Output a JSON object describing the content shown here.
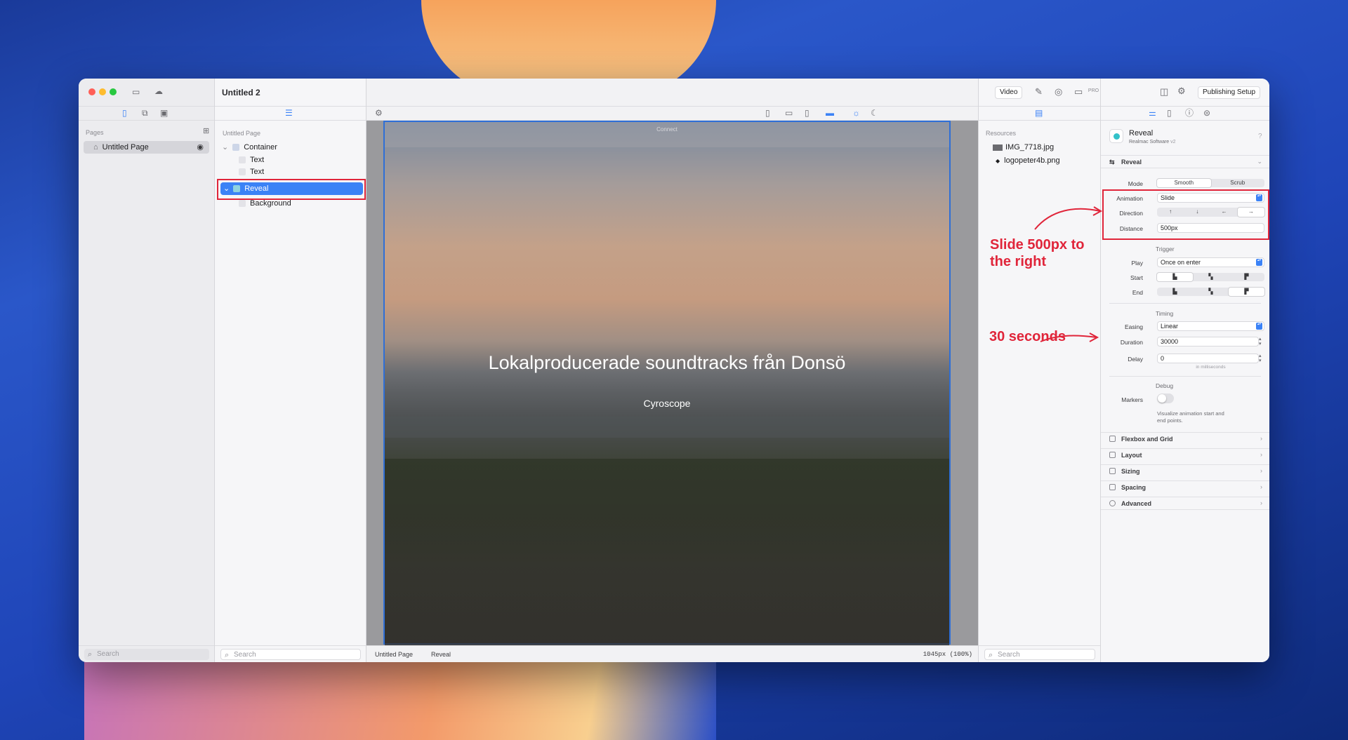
{
  "window": {
    "title": "Untitled 2",
    "license": "PRO LICENSE",
    "video_button": "Video",
    "publishing_button": "Publishing Setup"
  },
  "sidebar": {
    "section": "Pages",
    "pages": [
      {
        "label": "Untitled Page"
      }
    ],
    "search_placeholder": "Search"
  },
  "layers": {
    "header": "Untitled Page",
    "items": [
      {
        "label": "Container",
        "depth": 0
      },
      {
        "label": "Text",
        "depth": 1
      },
      {
        "label": "Text",
        "depth": 1
      },
      {
        "label": "Reveal",
        "depth": 0,
        "selected": true
      },
      {
        "label": "Background",
        "depth": 1
      }
    ],
    "search_placeholder": "Search"
  },
  "canvas": {
    "connect_label": "Connect",
    "title": "Lokalproducerade soundtracks från Donsö",
    "subtitle": "Cyroscope",
    "breadcrumb": [
      "Untitled Page",
      "Reveal"
    ],
    "size_readout": "1045px (100%)"
  },
  "resources": {
    "section": "Resources",
    "files": [
      {
        "name": "IMG_7718.jpg"
      },
      {
        "name": "logopeter4b.png"
      }
    ],
    "search_placeholder": "Search"
  },
  "inspector": {
    "component_name": "Reveal",
    "component_vendor": "Realmac Software",
    "component_version": "v2",
    "section_title": "Reveal",
    "mode": {
      "label": "Mode",
      "options": [
        "Smooth",
        "Scrub"
      ],
      "selected": "Smooth"
    },
    "animation": {
      "label": "Animation",
      "value": "Slide"
    },
    "direction": {
      "label": "Direction",
      "options": [
        "↑",
        "↓",
        "←",
        "→"
      ],
      "selected": "→"
    },
    "distance": {
      "label": "Distance",
      "value": "500px"
    },
    "trigger_group": "Trigger",
    "play": {
      "label": "Play",
      "value": "Once on enter"
    },
    "start": {
      "label": "Start"
    },
    "end": {
      "label": "End"
    },
    "timing_group": "Timing",
    "easing": {
      "label": "Easing",
      "value": "Linear"
    },
    "duration": {
      "label": "Duration",
      "value": "30000"
    },
    "delay": {
      "label": "Delay",
      "value": "0"
    },
    "ms_hint": "in milliseconds",
    "debug_group": "Debug",
    "markers": {
      "label": "Markers",
      "hint": "Visualize animation start and end points."
    },
    "sections": [
      "Flexbox and Grid",
      "Layout",
      "Sizing",
      "Spacing",
      "Advanced"
    ]
  },
  "annotations": {
    "slide_note": "Slide 500px to the right",
    "slide_line1": "Slide 500px to",
    "slide_line2": "the right",
    "duration_note": "30 seconds",
    "color": "#e0253a"
  }
}
